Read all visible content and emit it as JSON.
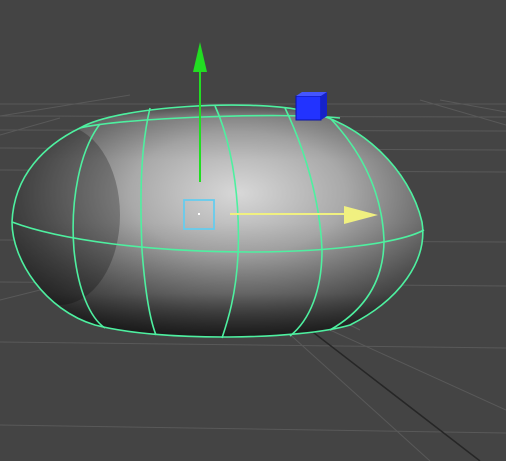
{
  "viewport": {
    "background": "#444444",
    "grid_color": "#5a5a5a",
    "grid_color_dark": "#3c3c3c"
  },
  "object": {
    "shape": "nurbs-capsule",
    "wireframe_color": "#4ef0a0",
    "selected": true
  },
  "manipulator": {
    "type": "move-tool",
    "y_axis_color": "#22dd22",
    "x_axis_color": "#f0f080",
    "center_handle_color": "#66ccee",
    "z_handle_color": "#2233ff"
  }
}
